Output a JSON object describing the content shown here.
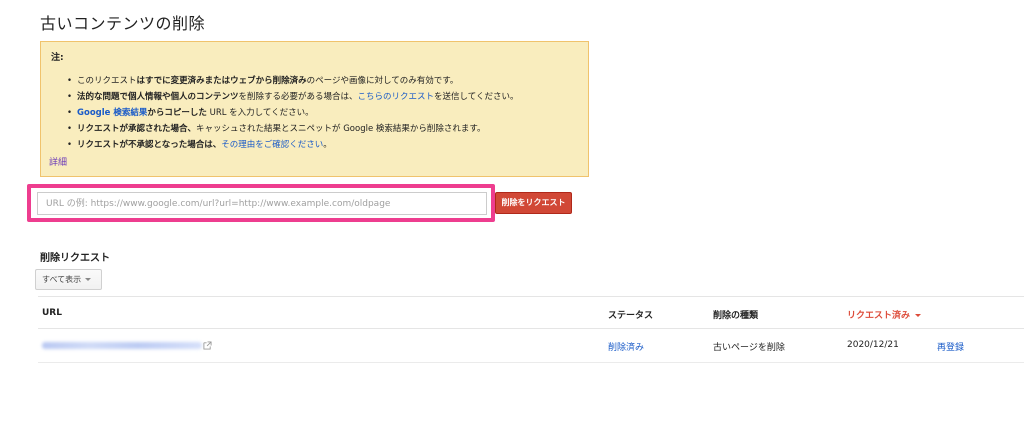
{
  "page": {
    "title": "古いコンテンツの削除"
  },
  "notice": {
    "heading": "注:",
    "items": [
      {
        "a": "このリクエスト",
        "b": "は",
        "c": "すでに変更済みまたはウェブから削除済み",
        "d": "のページや画像に対してのみ有効です。"
      },
      {
        "a": "法的な問題で個人情報や個人のコンテンツ",
        "b": "を削除する必要がある場合は、",
        "c": "こちらのリクエスト",
        "d": "を送信してください。"
      },
      {
        "a": "Google 検索結果",
        "b": "からコピーした",
        "c": " URL を入力してください。"
      },
      {
        "a": "リクエストが承認された場合、",
        "b": "キャッシュされた結果とスニペットが Google 検索結果から削除されます。"
      },
      {
        "a": "リクエストが不承認となった場合は、",
        "b": "その理由をご確認ください",
        "c": "。"
      }
    ],
    "details_link": "詳細"
  },
  "form": {
    "url_placeholder": "URL の例: https://www.google.com/url?url=http://www.example.com/oldpage",
    "url_value": "",
    "submit_label": "削除をリクエスト"
  },
  "requests": {
    "title": "削除リクエスト",
    "filter_label": "すべて表示",
    "columns": {
      "url": "URL",
      "status": "ステータス",
      "type": "削除の種類",
      "date": "リクエスト済み"
    },
    "rows": [
      {
        "status": "削除済み",
        "type": "古いページを削除",
        "date": "2020/12/21",
        "action": "再登録"
      }
    ]
  },
  "colors": {
    "accent_red": "#d14836",
    "highlight_pink": "#ee3d8f",
    "link_blue": "#1a5bc8",
    "notice_bg": "#f9edbe"
  }
}
